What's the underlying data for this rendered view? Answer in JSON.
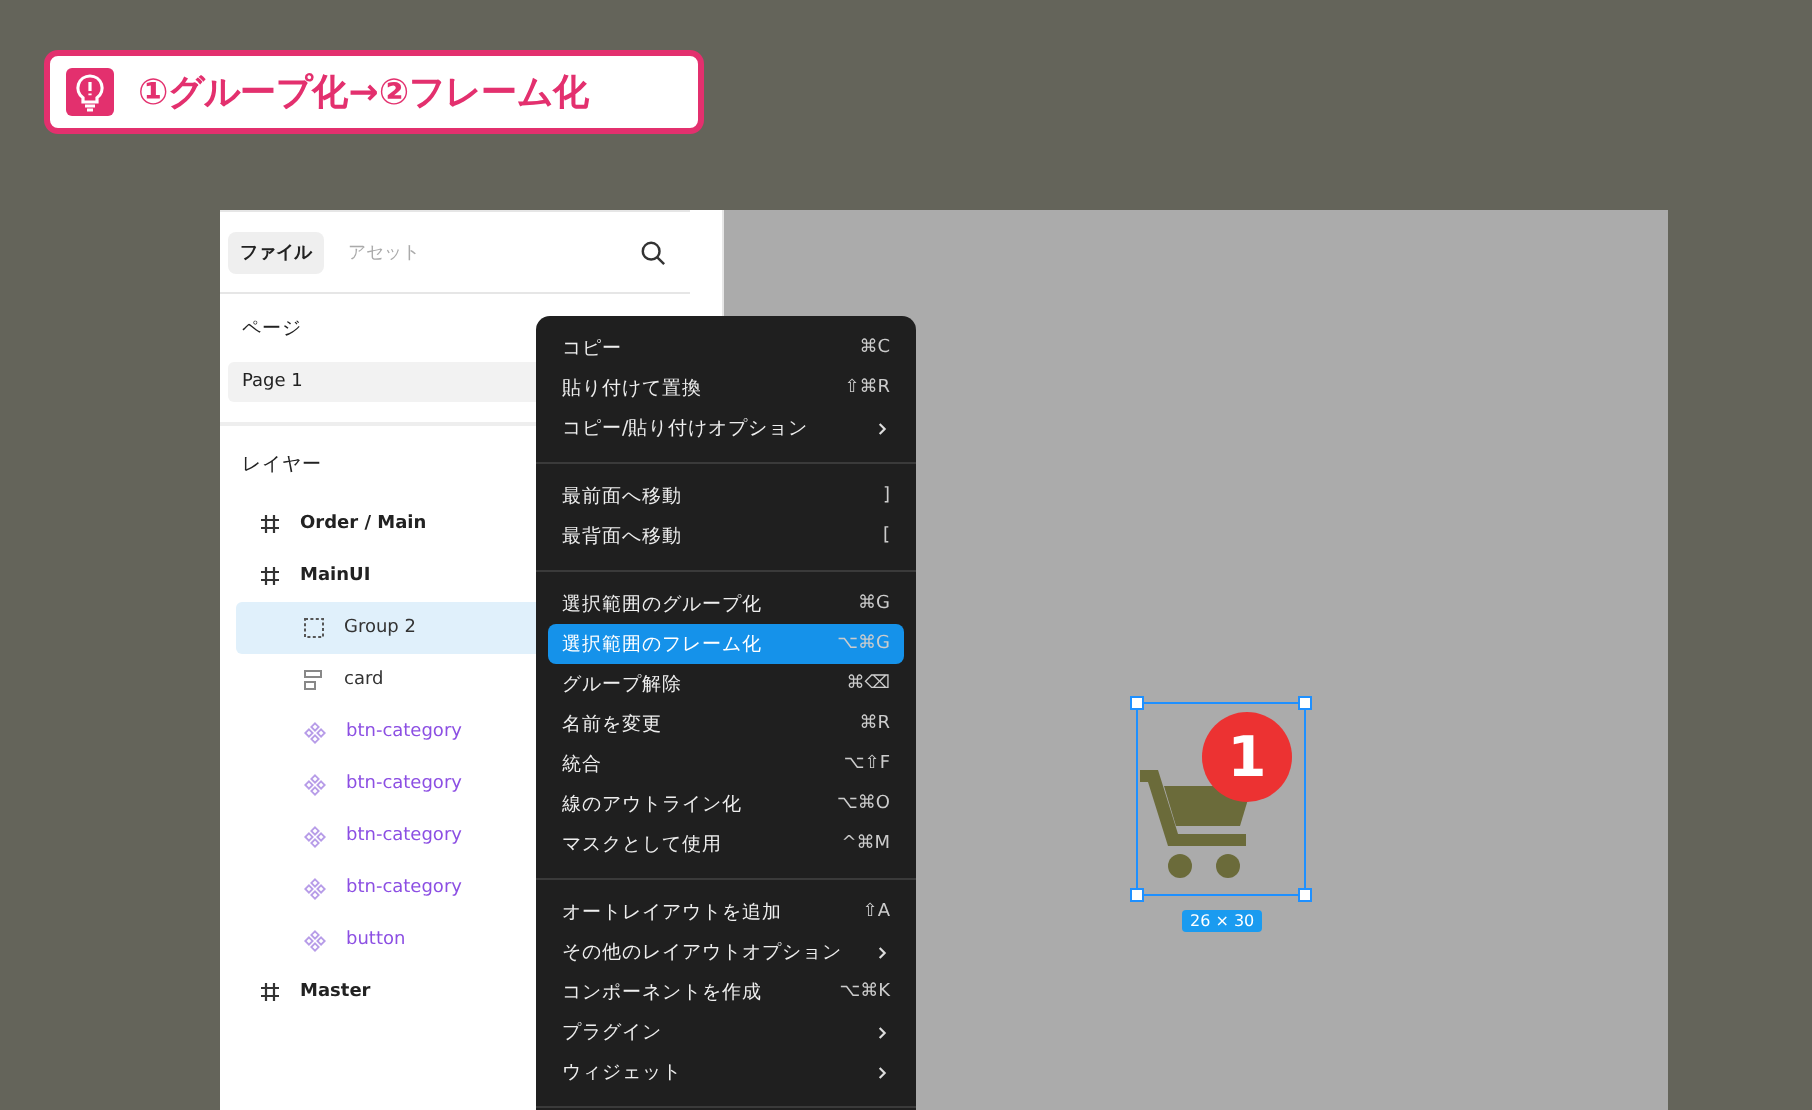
{
  "banner": {
    "title": "①グループ化→②フレーム化"
  },
  "sidebar": {
    "tabs": [
      {
        "label": "ファイル",
        "selected": true
      },
      {
        "label": "アセット",
        "selected": false
      }
    ],
    "pages_header": "ページ",
    "pages": [
      {
        "label": "Page 1",
        "selected": true
      }
    ],
    "layers_header": "レイヤー",
    "layers": [
      {
        "kind": "frame",
        "name": "Order / Main",
        "selected": false
      },
      {
        "kind": "frame",
        "name": "MainUI",
        "selected": false,
        "children": [
          {
            "kind": "group",
            "name": "Group 2",
            "selected": true
          },
          {
            "kind": "rect",
            "name": "card",
            "selected": false
          },
          {
            "kind": "instance",
            "name": "btn-category",
            "selected": false
          },
          {
            "kind": "instance",
            "name": "btn-category",
            "selected": false
          },
          {
            "kind": "instance",
            "name": "btn-category",
            "selected": false
          },
          {
            "kind": "instance",
            "name": "btn-category",
            "selected": false
          },
          {
            "kind": "instance",
            "name": "button",
            "selected": false
          }
        ]
      },
      {
        "kind": "frame",
        "name": "Master",
        "selected": false
      }
    ]
  },
  "context_menu": {
    "groups": [
      [
        {
          "label": "コピー",
          "shortcut": "⌘C",
          "submenu": false,
          "selected": false
        },
        {
          "label": "貼り付けて置換",
          "shortcut": "⇧⌘R",
          "submenu": false,
          "selected": false
        },
        {
          "label": "コピー/貼り付けオプション",
          "submenu": true,
          "selected": false
        }
      ],
      [
        {
          "label": "最前面へ移動",
          "shortcut": "]",
          "submenu": false,
          "selected": false
        },
        {
          "label": "最背面へ移動",
          "shortcut": "[",
          "submenu": false,
          "selected": false
        }
      ],
      [
        {
          "label": "選択範囲のグループ化",
          "shortcut": "⌘G",
          "submenu": false,
          "selected": false
        },
        {
          "label": "選択範囲のフレーム化",
          "shortcut": "⌥⌘G",
          "submenu": false,
          "selected": true
        },
        {
          "label": "グループ解除",
          "shortcut": "⌘⌫",
          "submenu": false,
          "selected": false
        },
        {
          "label": "名前を変更",
          "shortcut": "⌘R",
          "submenu": false,
          "selected": false
        },
        {
          "label": "統合",
          "shortcut": "⌥⇧F",
          "submenu": false,
          "selected": false
        },
        {
          "label": "線のアウトライン化",
          "shortcut": "⌥⌘O",
          "submenu": false,
          "selected": false
        },
        {
          "label": "マスクとして使用",
          "shortcut": "^⌘M",
          "submenu": false,
          "selected": false
        }
      ],
      [
        {
          "label": "オートレイアウトを追加",
          "shortcut": "⇧A",
          "submenu": false,
          "selected": false
        },
        {
          "label": "その他のレイアウトオプション",
          "submenu": true,
          "selected": false
        },
        {
          "label": "コンポーネントを作成",
          "shortcut": "⌥⌘K",
          "submenu": false,
          "selected": false
        },
        {
          "label": "プラグイン",
          "submenu": true,
          "selected": false
        },
        {
          "label": "ウィジェット",
          "submenu": true,
          "selected": false
        }
      ]
    ]
  },
  "canvas": {
    "badge": "1",
    "dimensions": "26 × 30"
  }
}
